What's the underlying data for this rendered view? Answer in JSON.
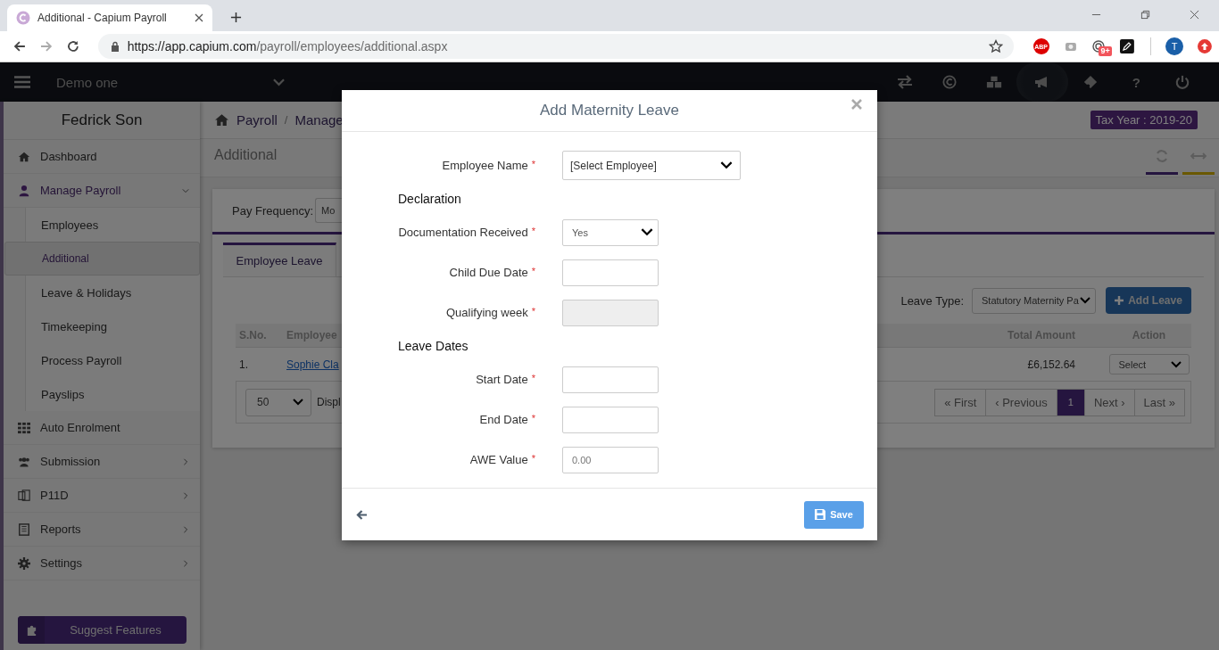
{
  "browser": {
    "tab_title": "Additional - Capium Payroll",
    "url_host": "https://app.capium.com",
    "url_path": "/payroll/employees/additional.aspx",
    "abp_label": "ABP",
    "notification_badge": "9+",
    "profile_initial": "T"
  },
  "topbar": {
    "company": "Demo one",
    "help_label": "?"
  },
  "sidebar": {
    "user": "Fedrick Son",
    "items": [
      {
        "label": "Dashboard"
      },
      {
        "label": "Manage Payroll",
        "expanded": true,
        "children": [
          {
            "label": "Employees",
            "selected": false
          },
          {
            "label": "Additional",
            "selected": true
          },
          {
            "label": "Leave & Holidays",
            "selected": false
          },
          {
            "label": "Timekeeping",
            "selected": false
          },
          {
            "label": "Process Payroll",
            "selected": false
          },
          {
            "label": "Payslips",
            "selected": false
          }
        ]
      },
      {
        "label": "Auto Enrolment"
      },
      {
        "label": "Submission",
        "expanded": false
      },
      {
        "label": "P11D",
        "expanded": false
      },
      {
        "label": "Reports",
        "expanded": false
      },
      {
        "label": "Settings",
        "expanded": false
      }
    ],
    "suggest_button": "Suggest Features"
  },
  "breadcrumb": [
    "Payroll",
    "Manage"
  ],
  "breadcrumb_separator": "/",
  "tax_year": "Tax Year : 2019-20",
  "page_title": "Additional",
  "card": {
    "pay_frequency_label": "Pay Frequency:",
    "pay_frequency_value": "Mo",
    "tabs": [
      {
        "label": "Employee Leave",
        "selected": true
      }
    ],
    "leave_type_label": "Leave Type:",
    "leave_type_value": "Statutory Maternity Pa",
    "add_button": "Add Leave",
    "columns": [
      "S.No.",
      "Employee",
      "Total Amount",
      "Action"
    ],
    "rows": [
      {
        "cells": [
          "1.",
          "Sophie Cla",
          "£6,152.64",
          "Select"
        ]
      }
    ],
    "page_size": "50",
    "display_text": "Displ",
    "pagination": [
      {
        "label": "« First",
        "selected": false
      },
      {
        "label": "‹ Previous",
        "selected": false
      },
      {
        "label": "1",
        "selected": true
      },
      {
        "label": "Next ›",
        "selected": false
      },
      {
        "label": "Last »",
        "selected": false
      }
    ]
  },
  "modal": {
    "title": "Add Maternity Leave",
    "required_mark": "*",
    "fields": [
      {
        "kind": "select",
        "label": "Employee Name",
        "required": true,
        "value": "[Select Employee]"
      },
      {
        "kind": "heading",
        "label": "Declaration"
      },
      {
        "kind": "select",
        "label": "Documentation Received",
        "required": true,
        "value": "Yes"
      },
      {
        "kind": "input",
        "label": "Child Due Date",
        "required": true
      },
      {
        "kind": "input",
        "label": "Qualifying week",
        "required": true,
        "disabled": true
      },
      {
        "kind": "heading",
        "label": "Leave Dates"
      },
      {
        "kind": "input",
        "label": "Start Date",
        "required": true
      },
      {
        "kind": "input",
        "label": "End Date",
        "required": true
      },
      {
        "kind": "input",
        "label": "AWE Value",
        "required": true,
        "placeholder": "0.00"
      }
    ],
    "save_button": "Save"
  }
}
